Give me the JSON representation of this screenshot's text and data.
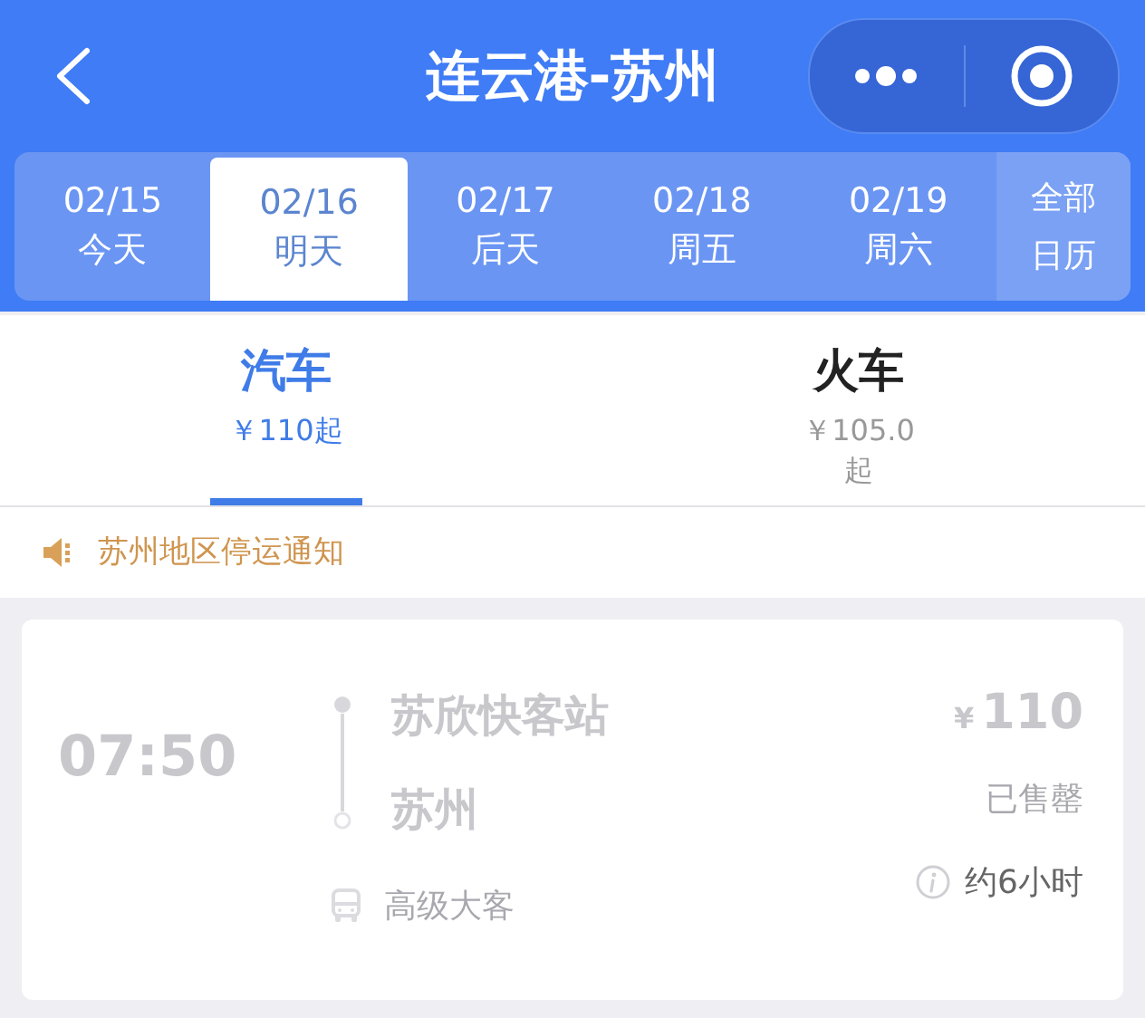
{
  "header": {
    "title": "连云港-苏州"
  },
  "dates": [
    {
      "date": "02/15",
      "day": "今天",
      "selected": false
    },
    {
      "date": "02/16",
      "day": "明天",
      "selected": true
    },
    {
      "date": "02/17",
      "day": "后天",
      "selected": false
    },
    {
      "date": "02/18",
      "day": "周五",
      "selected": false
    },
    {
      "date": "02/19",
      "day": "周六",
      "selected": false
    }
  ],
  "calendar_button": {
    "line1": "全部",
    "line2": "日历"
  },
  "modes": [
    {
      "label": "汽车",
      "price": "￥110起",
      "selected": true
    },
    {
      "label": "火车",
      "price": "￥105.0起",
      "selected": false
    }
  ],
  "notice": "苏州地区停运通知",
  "trips": [
    {
      "time": "07:50",
      "from": "苏欣快客站",
      "to": "苏州",
      "currency": "¥",
      "amount": "110",
      "status": "已售罄",
      "sold_out": true,
      "bus_type": "高级大客",
      "duration": "约6小时"
    }
  ]
}
